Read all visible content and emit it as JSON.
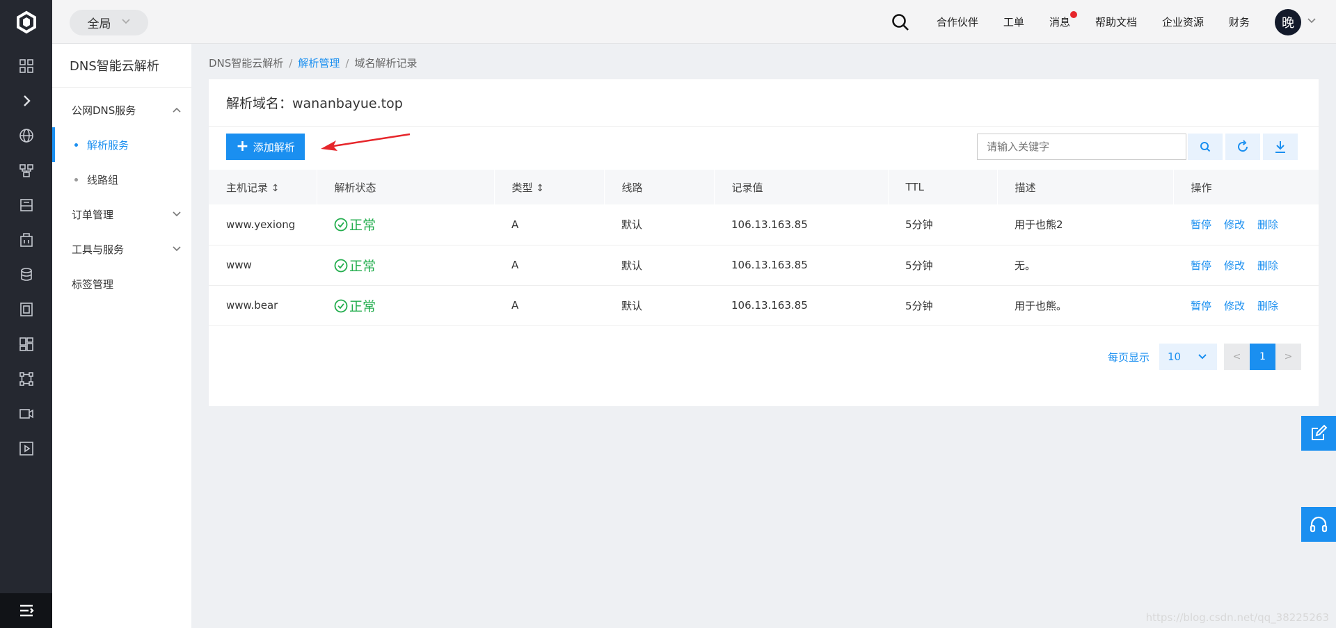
{
  "topbar": {
    "scope_label": "全局",
    "nav": [
      {
        "label": "合作伙伴"
      },
      {
        "label": "工单"
      },
      {
        "label": "消息"
      },
      {
        "label": "帮助文档"
      },
      {
        "label": "企业资源"
      },
      {
        "label": "财务"
      }
    ],
    "avatar_text": "晚"
  },
  "rail": {
    "icons": [
      "grid-icon",
      "expand-chevron-icon",
      "globe-icon",
      "network-icon",
      "storage-icon",
      "building-icon",
      "database-icon",
      "server-icon",
      "dashboard-icon",
      "topology-icon",
      "video-icon",
      "play-icon"
    ]
  },
  "sidebar": {
    "title": "DNS智能云解析",
    "groups": [
      {
        "label": "公网DNS服务",
        "expanded": true,
        "items": [
          {
            "label": "解析服务",
            "active": true
          },
          {
            "label": "线路组",
            "active": false
          }
        ]
      },
      {
        "label": "订单管理",
        "expanded": false
      },
      {
        "label": "工具与服务",
        "expanded": false
      },
      {
        "label": "标签管理"
      }
    ]
  },
  "breadcrumb": {
    "items": [
      "DNS智能云解析",
      "解析管理",
      "域名解析记录"
    ],
    "separator": "/"
  },
  "panel": {
    "title": "解析域名：wananbayue.top",
    "add_button": "添加解析",
    "search_placeholder": "请输入关键字"
  },
  "table": {
    "headers": [
      "主机记录",
      "解析状态",
      "类型",
      "线路",
      "记录值",
      "TTL",
      "描述",
      "操作"
    ],
    "rows": [
      {
        "host": "www.yexiong",
        "status": "正常",
        "type": "A",
        "line": "默认",
        "value": "106.13.163.85",
        "ttl": "5分钟",
        "desc": "用于也熊2"
      },
      {
        "host": "www",
        "status": "正常",
        "type": "A",
        "line": "默认",
        "value": "106.13.163.85",
        "ttl": "5分钟",
        "desc": "无。"
      },
      {
        "host": "www.bear",
        "status": "正常",
        "type": "A",
        "line": "默认",
        "value": "106.13.163.85",
        "ttl": "5分钟",
        "desc": "用于也熊。"
      }
    ],
    "actions": [
      "暂停",
      "修改",
      "删除"
    ]
  },
  "pager": {
    "label": "每页显示",
    "page_size": "10",
    "prev": "<",
    "current": "1",
    "next": ">"
  },
  "watermark": "https://blog.csdn.net/qq_38225263",
  "colors": {
    "accent": "#1a8ff0",
    "ok": "#22ad4d",
    "rail": "#252830",
    "badge": "#e6262b"
  }
}
